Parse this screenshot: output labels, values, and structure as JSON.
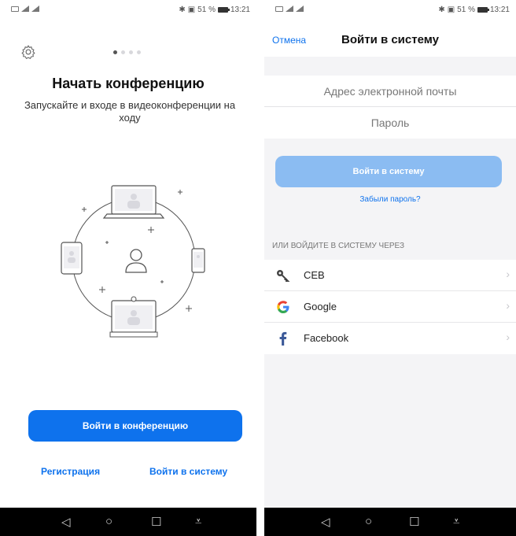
{
  "status": {
    "time": "13:21",
    "battery": "51 %"
  },
  "start_screen": {
    "title": "Начать конференцию",
    "subtitle": "Запускайте и входе в видеоконференции на ходу",
    "join_button": "Войти в конференцию",
    "register_link": "Регистрация",
    "signin_link": "Войти в систему",
    "carousel_pages": 4,
    "carousel_active": 1
  },
  "login_screen": {
    "cancel": "Отмена",
    "title": "Войти в систему",
    "email_placeholder": "Адрес электронной почты",
    "password_placeholder": "Пароль",
    "login_button": "Войти в систему",
    "forgot": "Забыли пароль?",
    "or_label": "ИЛИ ВОЙДИТЕ В СИСТЕМУ ЧЕРЕЗ",
    "providers": [
      {
        "label": "CEB",
        "icon": "key-icon"
      },
      {
        "label": "Google",
        "icon": "google-icon"
      },
      {
        "label": "Facebook",
        "icon": "facebook-icon"
      }
    ]
  },
  "nav": {
    "back": "◁",
    "home": "○",
    "recent": "☐",
    "menu": "⩡"
  },
  "colors": {
    "accent": "#0e72ed",
    "accent_disabled": "#8bbcf2"
  }
}
